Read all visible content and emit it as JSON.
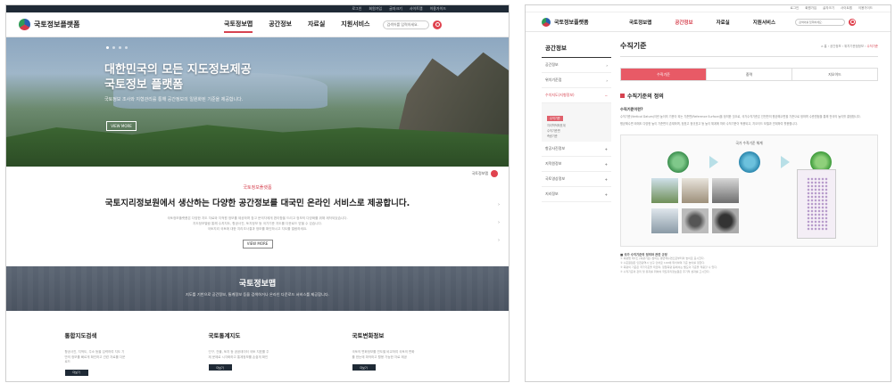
{
  "left": {
    "util_links": [
      "로그인",
      "회원가입",
      "글자크기",
      "사이트맵",
      "이용가이드"
    ],
    "logo_text": "국토정보플랫폼",
    "menu": [
      {
        "label": "국토정보맵",
        "active": true
      },
      {
        "label": "공간정보",
        "active": false
      },
      {
        "label": "자료실",
        "active": false
      },
      {
        "label": "지원서비스",
        "active": false
      }
    ],
    "search_placeholder": "검색어를 입력하세요.",
    "hero": {
      "title_line1": "대한민국의 모든 지도정보제공",
      "title_line2": "국토정보 플랫폼",
      "subtitle": "국토정보 조사와 지형관리를 통해 공간정보의 일원화된 기준을 제공합니다.",
      "button": "VIEW MORE"
    },
    "intro": {
      "badge": "국토정보맵",
      "kicker": "국토정보플랫폼",
      "title": "국토지리정보원에서 생산하는 다양한 공간정보를 대국민 온라인 서비스로 제공합니다.",
      "desc_lines": [
        "국토정보플랫폼은 다양한 지도 자료와 지적원 정보를 제공하며 참고 문의자에게 편리함을 드리고 정보의 다양화를 위해 제작되었습니다.",
        "지도정보열람 통해 수치지도, 항공사진, 토지정보 등 국가기준 지도를 다운로드 받을 수 있습니다.",
        "국토지리 국토에 대한 지리조사결과 정보를 확인하시고 지도를 열람하세요."
      ],
      "button": "VIEW MORE"
    },
    "band": {
      "title": "국토정보맵",
      "subtitle": "지도를 기반으로 공간정보, 통계정보 등을 검색하거나 온라인 다운로드 서비스를 제공합니다."
    },
    "services": [
      {
        "title": "통합지도검색",
        "desc": "항공사진, 지적도, 주소 등을 입력하여 지도 기반의 정보를 빠르게 확인하고 관련 자료를 다운로드",
        "button": "더보기"
      },
      {
        "title": "국토통계지도",
        "desc": "인구, 건물, 토지 등 공공데이터 국토 지표를 주제 문제로 시각화하고 통계정보를 손쉽게 확인",
        "button": "더보기"
      },
      {
        "title": "국토변화정보",
        "desc": "국토의 변화정보를 연도별 비교하여 국토의 변화를 한눈에 파악하고 활용 가능한 자료 제공",
        "button": "더보기"
      }
    ]
  },
  "right": {
    "util_links": [
      "로그인",
      "회원가입",
      "글자크기",
      "사이트맵",
      "이용가이드"
    ],
    "logo_text": "국토정보플랫폼",
    "menu": [
      {
        "label": "국토정보맵",
        "active": false
      },
      {
        "label": "공간정보",
        "active": true
      },
      {
        "label": "자료실",
        "active": false
      },
      {
        "label": "지원서비스",
        "active": false
      }
    ],
    "search_placeholder": "검색어를 입력하세요.",
    "lnb": {
      "heading": "공간정보",
      "items": [
        {
          "label": "공간정보",
          "active": false
        },
        {
          "label": "위치기준점",
          "active": false
        },
        {
          "label": "수치지도(지형정보)",
          "active": true
        }
      ],
      "sub_items": [
        {
          "label": "수직기준",
          "active": true
        },
        {
          "label": "지리학적좌표계",
          "active": false
        },
        {
          "label": "수직기준면",
          "active": false
        },
        {
          "label": "측량기준",
          "active": false
        }
      ],
      "more_items": [
        "항공사진정보",
        "지적원정보",
        "국토영상정보",
        "지리정보"
      ]
    },
    "page": {
      "title": "수직기준",
      "breadcrumb": [
        "홈",
        "공간정보",
        "위치기준점정보",
        "수직기준"
      ],
      "tabs": [
        {
          "label": "수직기준",
          "active": true
        },
        {
          "label": "중력",
          "active": false
        },
        {
          "label": "지오이드",
          "active": false
        }
      ],
      "section_title": "수직기준의 정의",
      "question": "수직기준이란?",
      "paragraph1": "수직기준(Vertical Datum)이란 높이의 기준이 되는 기준면(Reference Surface)을 정의한 것으로, 국가수직기준은 인천만의 평균해수면을 기준으로 정하며 수준원점을 통해 전국의 높이를 결정합니다.",
      "paragraph2": "평균해수면 외에도 다양한 높이 기준면이 존재하며, 정표고 정규표고 등 높이 체계에 따라 수직기준이 적용되고, 지오이드 모델과 연계하여 활용합니다.",
      "figure_caption": "국가 수직기준 체계",
      "notes_head": "■ 국가 수직기준의 정의와 관련 규정",
      "notes": [
        "① 측량법 제7조 (측량기준) 높이는 평균해수면으로부터의 높이로 표시한다.",
        "② 수준원점은 인천광역시 남구 인하로 100에 위치하며 기준 높이를 정한다.",
        "③ 측량의 기준은 국가기준을 따르며, 정밀측량 등에서는 별도의 기준을 적용할 수 있다.",
        "④ 수직기준의 관리 및 유지를 위하여 국토지리정보원은 주기적 성과를 고시한다."
      ]
    }
  }
}
